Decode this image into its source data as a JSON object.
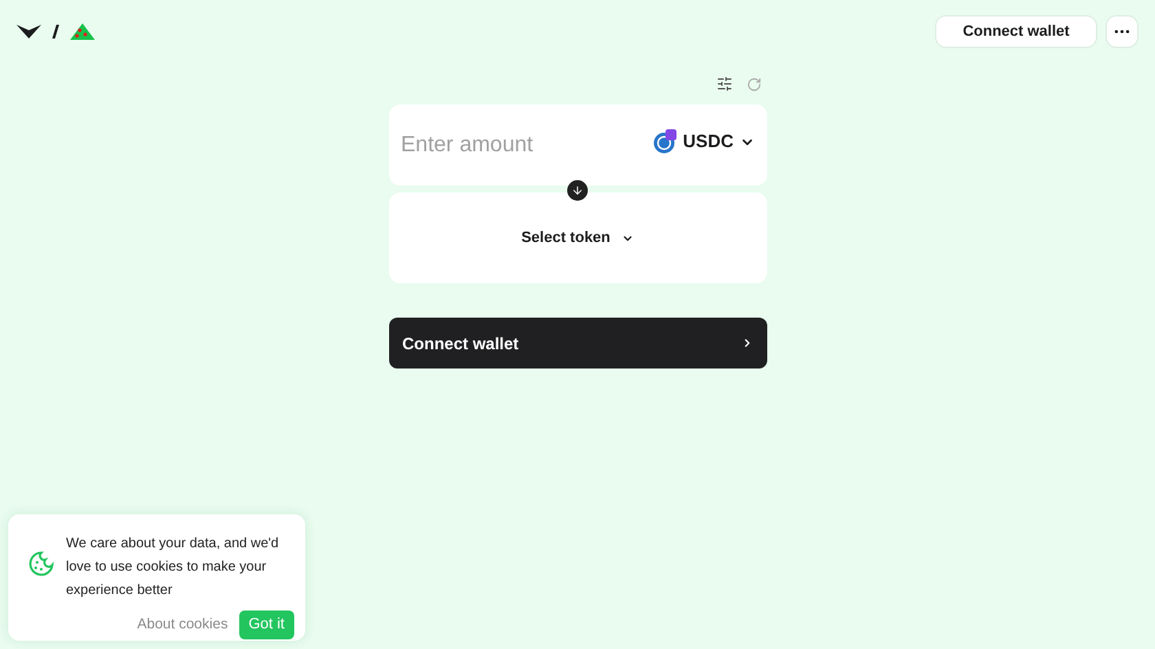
{
  "header": {
    "connect_button": "Connect wallet"
  },
  "swap": {
    "amount_placeholder": "Enter amount",
    "from_token": "USDC",
    "to_token": "Select token",
    "submit": "Connect wallet"
  },
  "cookie_banner": {
    "message": "We care about your data, and we'd love to use cookies to make your experience better",
    "link": "About cookies",
    "accept": "Got it"
  }
}
